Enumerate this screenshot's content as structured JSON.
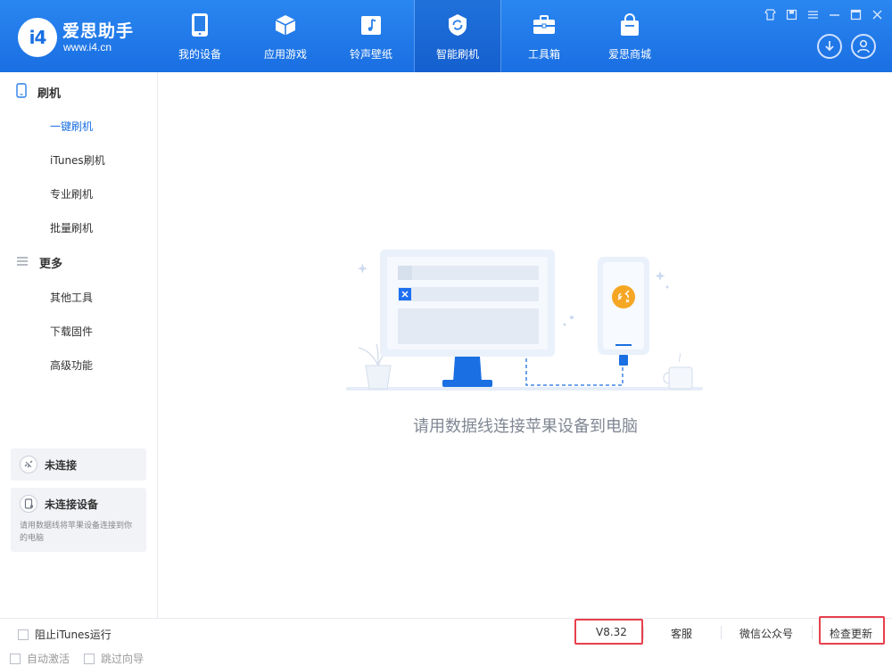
{
  "brand": {
    "name": "爱思助手",
    "url": "www.i4.cn",
    "logo_text": "i4"
  },
  "nav": {
    "tabs": [
      {
        "label": "我的设备",
        "icon": "phone-icon"
      },
      {
        "label": "应用游戏",
        "icon": "cube-icon"
      },
      {
        "label": "铃声壁纸",
        "icon": "music-folder-icon"
      },
      {
        "label": "智能刷机",
        "icon": "refresh-shield-icon",
        "active": true
      },
      {
        "label": "工具箱",
        "icon": "toolbox-icon"
      },
      {
        "label": "爱思商城",
        "icon": "shopping-bag-icon"
      }
    ]
  },
  "sidebar": {
    "flash": {
      "title": "刷机",
      "items": [
        "一键刷机",
        "iTunes刷机",
        "专业刷机",
        "批量刷机"
      ],
      "active_index": 0
    },
    "more": {
      "title": "更多",
      "items": [
        "其他工具",
        "下载固件",
        "高级功能"
      ]
    },
    "status": {
      "connection": "未连接",
      "device_title": "未连接设备",
      "device_desc": "请用数据线将苹果设备连接到你的电脑"
    },
    "checkboxes": {
      "auto_activate": "自动激活",
      "skip_guide": "跳过向导"
    }
  },
  "main": {
    "hint": "请用数据线连接苹果设备到电脑"
  },
  "bottom": {
    "block_itunes": "阻止iTunes运行",
    "version": "V8.32",
    "support": "客服",
    "wechat": "微信公众号",
    "check_update": "检查更新"
  },
  "colors": {
    "primary": "#1a6fe2",
    "accent_orange": "#f5a623",
    "highlight": "#e8404c"
  }
}
